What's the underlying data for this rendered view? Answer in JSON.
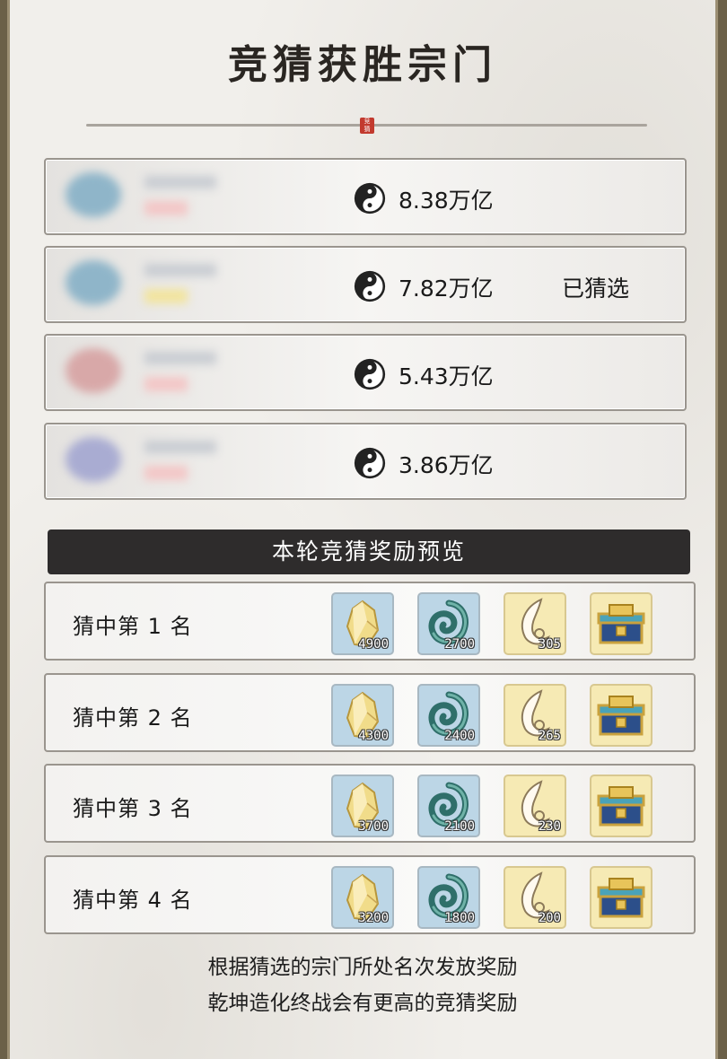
{
  "title": "竞猜获胜宗门",
  "seal_text": "竞猜",
  "sects": [
    {
      "amount": "8.38万亿",
      "picked": "",
      "badge_color": "#8fb5c9",
      "tag_color": "#f3c6c6"
    },
    {
      "amount": "7.82万亿",
      "picked": "已猜选",
      "badge_color": "#8fb5c9",
      "tag_color": "#f2e49c"
    },
    {
      "amount": "5.43万亿",
      "picked": "",
      "badge_color": "#d8a8a8",
      "tag_color": "#f3c6c6"
    },
    {
      "amount": "3.86万亿",
      "picked": "",
      "badge_color": "#a9acd2",
      "tag_color": "#f3c6c6"
    }
  ],
  "reward_banner": "本轮竞猜奖励预览",
  "rewards": [
    {
      "label": "猜中第 1 名",
      "counts": [
        "4900",
        "2700",
        "305",
        ""
      ]
    },
    {
      "label": "猜中第 2 名",
      "counts": [
        "4300",
        "2400",
        "265",
        ""
      ]
    },
    {
      "label": "猜中第 3 名",
      "counts": [
        "3700",
        "2100",
        "230",
        ""
      ]
    },
    {
      "label": "猜中第 4 名",
      "counts": [
        "3200",
        "1800",
        "200",
        ""
      ]
    }
  ],
  "item_icons": [
    "crystal-icon",
    "jade-swirl-icon",
    "crescent-jade-icon",
    "treasure-chest-icon"
  ],
  "footer": {
    "line1": "根据猜选的宗门所处名次发放奖励",
    "line2": "乾坤造化终战会有更高的竞猜奖励"
  }
}
